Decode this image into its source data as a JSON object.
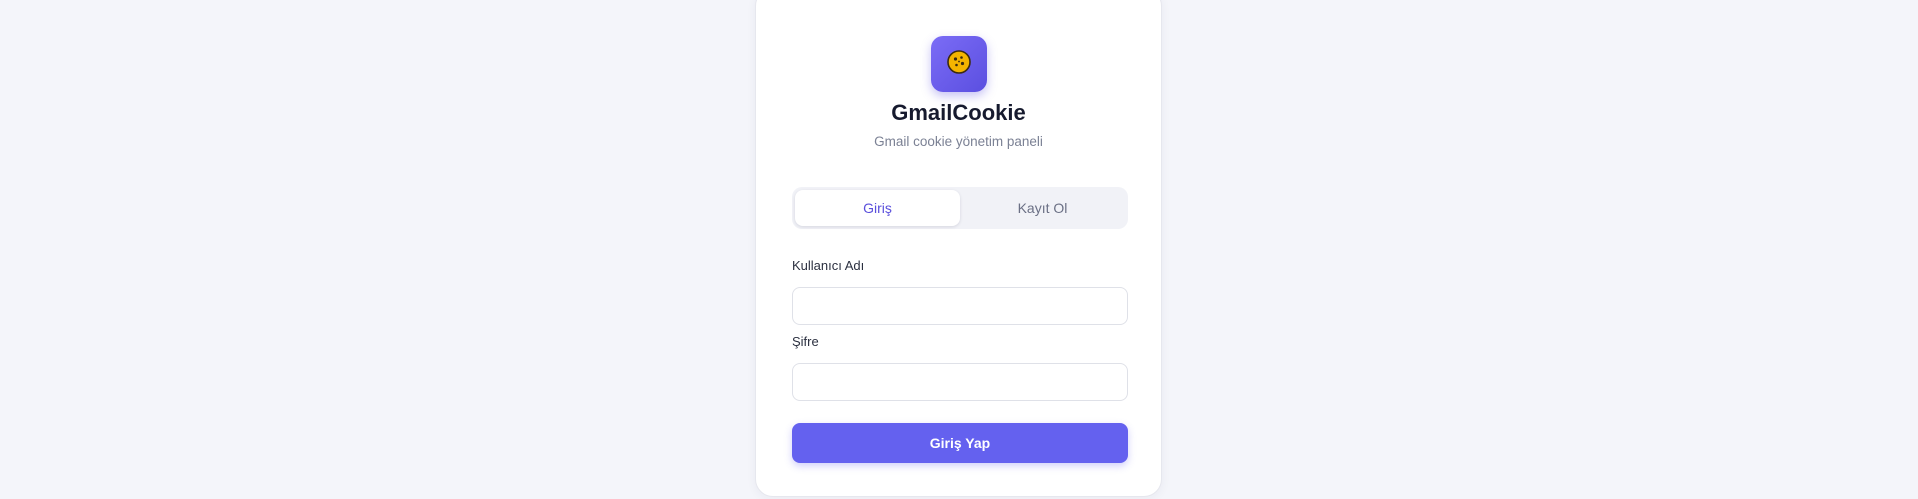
{
  "app": {
    "title": "GmailCookie",
    "subtitle": "Gmail cookie yönetim paneli",
    "logo_icon": "cookie-icon",
    "accent_color": "#6461ef"
  },
  "tabs": [
    {
      "label": "Giriş",
      "active": true
    },
    {
      "label": "Kayıt Ol",
      "active": false
    }
  ],
  "form": {
    "username": {
      "label": "Kullanıcı Adı",
      "value": "",
      "placeholder": ""
    },
    "password": {
      "label": "Şifre",
      "value": "",
      "placeholder": ""
    },
    "submit_label": "Giriş Yap"
  }
}
